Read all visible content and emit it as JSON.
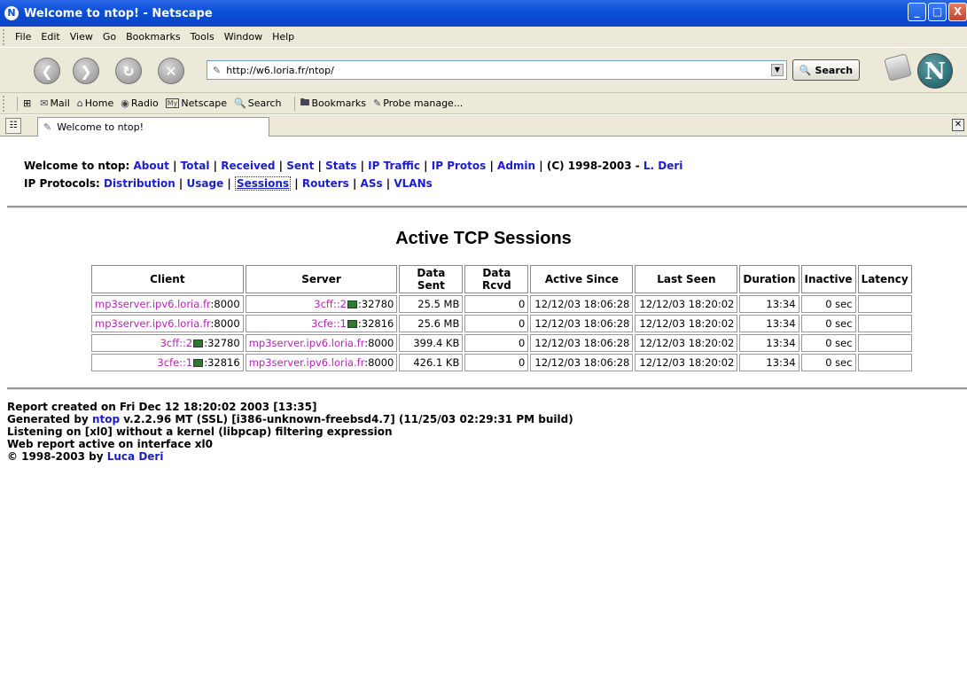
{
  "window": {
    "title": "Welcome to ntop! - Netscape",
    "min": "_",
    "max": "□",
    "close": "X"
  },
  "menubar": [
    "File",
    "Edit",
    "View",
    "Go",
    "Bookmarks",
    "Tools",
    "Window",
    "Help"
  ],
  "navbar": {
    "url": "http://w6.loria.fr/ntop/",
    "search_label": "Search"
  },
  "personal_toolbar": [
    {
      "icon": "mail-icon",
      "label": "Mail"
    },
    {
      "icon": "home-icon",
      "label": "Home"
    },
    {
      "icon": "radio-icon",
      "label": "Radio"
    },
    {
      "icon": "my-netscape-icon",
      "label": "Netscape"
    },
    {
      "icon": "search-icon",
      "label": "Search"
    },
    {
      "icon": "bookmarks-icon",
      "label": "Bookmarks"
    },
    {
      "icon": "link-icon",
      "label": "Probe manage..."
    }
  ],
  "tab": {
    "label": "Welcome to ntop!"
  },
  "nav": {
    "line1_prefix": "Welcome to ntop:",
    "line1_links": [
      "About",
      "Total",
      "Received",
      "Sent",
      "Stats",
      "IP Traffic",
      "IP Protos",
      "Admin"
    ],
    "copyright": "(C) 1998-2003 -",
    "author": "L. Deri",
    "line2_prefix": "IP Protocols:",
    "line2_links": [
      "Distribution",
      "Usage",
      "Sessions",
      "Routers",
      "ASs",
      "VLANs"
    ]
  },
  "heading": "Active TCP Sessions",
  "table": {
    "headers": [
      "Client",
      "Server",
      "Data Sent",
      "Data Rcvd",
      "Active Since",
      "Last Seen",
      "Duration",
      "Inactive",
      "Latency"
    ],
    "rows": [
      {
        "client_host": "mp3server.ipv6.loria.fr",
        "client_port": ":8000",
        "client_chip": false,
        "server_host": "3cff::2",
        "server_port": ":32780",
        "server_chip": true,
        "sent": "25.5 MB",
        "rcvd": "0",
        "since": "12/12/03 18:06:28",
        "seen": "12/12/03 18:20:02",
        "duration": "13:34",
        "inactive": "0 sec",
        "latency": ""
      },
      {
        "client_host": "mp3server.ipv6.loria.fr",
        "client_port": ":8000",
        "client_chip": false,
        "server_host": "3cfe::1",
        "server_port": ":32816",
        "server_chip": true,
        "sent": "25.6 MB",
        "rcvd": "0",
        "since": "12/12/03 18:06:28",
        "seen": "12/12/03 18:20:02",
        "duration": "13:34",
        "inactive": "0 sec",
        "latency": ""
      },
      {
        "client_host": "3cff::2",
        "client_port": ":32780",
        "client_chip": true,
        "server_host": "mp3server.ipv6.loria.fr",
        "server_port": ":8000",
        "server_chip": false,
        "sent": "399.4 KB",
        "rcvd": "0",
        "since": "12/12/03 18:06:28",
        "seen": "12/12/03 18:20:02",
        "duration": "13:34",
        "inactive": "0 sec",
        "latency": ""
      },
      {
        "client_host": "3cfe::1",
        "client_port": ":32816",
        "client_chip": true,
        "server_host": "mp3server.ipv6.loria.fr",
        "server_port": ":8000",
        "server_chip": false,
        "sent": "426.1 KB",
        "rcvd": "0",
        "since": "12/12/03 18:06:28",
        "seen": "12/12/03 18:20:02",
        "duration": "13:34",
        "inactive": "0 sec",
        "latency": ""
      }
    ]
  },
  "footer": {
    "line1": "Report created on Fri Dec 12 18:20:02 2003 [13:35]",
    "line2_prefix": "Generated by",
    "line2_link": "ntop",
    "line2_suffix": "v.2.2.96 MT (SSL) [i386-unknown-freebsd4.7] (11/25/03 02:29:31 PM build)",
    "line3": "Listening on [xl0] without a kernel (libpcap) filtering expression",
    "line4": "Web report active on interface xl0",
    "line5_prefix": "© 1998-2003 by",
    "line5_link": "Luca Deri"
  }
}
